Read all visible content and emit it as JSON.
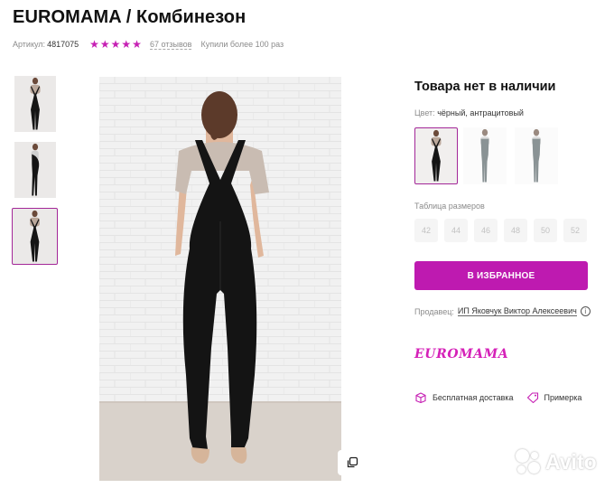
{
  "product": {
    "title": "EUROMAMA / Комбинезон",
    "article_label": "Артикул:",
    "article_value": "4817075",
    "rating_stars": 5,
    "reviews": "67 отзывов",
    "bought": "Купили более 100 раз"
  },
  "stock": {
    "status": "Товара нет в наличии"
  },
  "color": {
    "label": "Цвет:",
    "value": "чёрный, антрацитовый"
  },
  "sizes": {
    "label": "Таблица размеров",
    "items": [
      "42",
      "44",
      "46",
      "48",
      "50",
      "52"
    ]
  },
  "actions": {
    "favorite_label": "В ИЗБРАННОЕ"
  },
  "seller": {
    "label": "Продавец:",
    "name": "ИП Яковчук Виктор Алексеевич"
  },
  "brand": {
    "logo_text": "EUROMAMA"
  },
  "features": {
    "delivery": "Бесплатная доставка",
    "fitting": "Примерка"
  },
  "watermark": {
    "text": "Avito"
  },
  "colors": {
    "accent": "#be1ab0",
    "selected_border": "#a32798",
    "star": "#c620b4"
  }
}
